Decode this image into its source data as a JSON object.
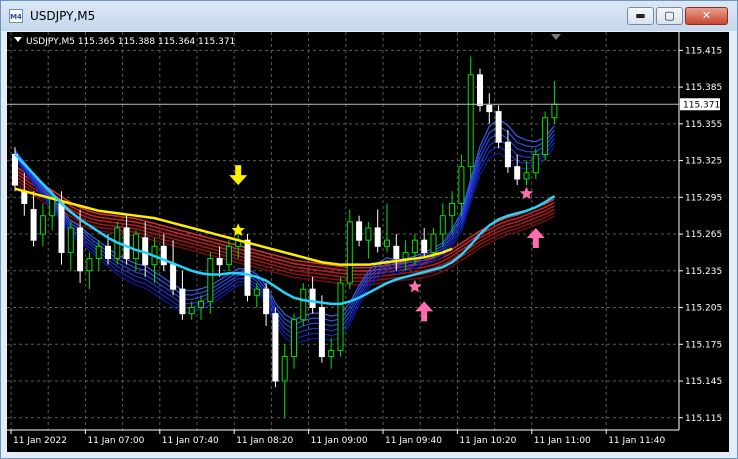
{
  "window": {
    "title": "USDJPY,M5",
    "app_icon_text": "M4",
    "buttons": {
      "minimize": "▬",
      "maximize": "▢",
      "close": "✕"
    }
  },
  "chart_data": {
    "type": "candlestick",
    "symbol_header": "USDJPY,M5  115.365 115.388 115.364 115.371",
    "bid": 115.371,
    "bid_label": "115.371",
    "ylim": [
      115.105,
      115.43
    ],
    "yticks": [
      "115.415",
      "115.385",
      "115.355",
      "115.325",
      "115.295",
      "115.265",
      "115.235",
      "115.205",
      "115.175",
      "115.145",
      "115.115"
    ],
    "xticks": [
      "11 Jan 2022",
      "11 Jan 07:00",
      "11 Jan 07:40",
      "11 Jan 08:20",
      "11 Jan 09:00",
      "11 Jan 09:40",
      "11 Jan 10:20",
      "11 Jan 11:00",
      "11 Jan 11:40"
    ],
    "grid": true,
    "colors": {
      "background": "#000000",
      "grid": "#5a5a5a",
      "bull_candle": "#00e000",
      "bear_candle": "#ffffff",
      "axis_text": "#ffffff",
      "bid_line": "#c0c0c0",
      "fast_ribbon": "#1a2fd6",
      "slow_ribbon": "#a01818",
      "cyan_line": "#22d4ff",
      "yellow_line": "#ffee00",
      "yellow_signal": "#ffee00",
      "pink_signal": "#ff6fb0"
    },
    "candles": [
      [
        115.33,
        115.336,
        115.3,
        115.305
      ],
      [
        115.3,
        115.315,
        115.28,
        115.29
      ],
      [
        115.285,
        115.3,
        115.255,
        115.26
      ],
      [
        115.265,
        115.29,
        115.255,
        115.28
      ],
      [
        115.28,
        115.3,
        115.268,
        115.295
      ],
      [
        115.29,
        115.3,
        115.24,
        115.25
      ],
      [
        115.25,
        115.275,
        115.235,
        115.27
      ],
      [
        115.27,
        115.285,
        115.225,
        115.235
      ],
      [
        115.235,
        115.25,
        115.22,
        115.245
      ],
      [
        115.245,
        115.26,
        115.235,
        115.255
      ],
      [
        115.255,
        115.265,
        115.24,
        115.245
      ],
      [
        115.245,
        115.275,
        115.24,
        115.27
      ],
      [
        115.27,
        115.28,
        115.24,
        115.245
      ],
      [
        115.245,
        115.268,
        115.235,
        115.265
      ],
      [
        115.262,
        115.275,
        115.23,
        115.24
      ],
      [
        115.24,
        115.262,
        115.225,
        115.255
      ],
      [
        115.255,
        115.265,
        115.235,
        115.24
      ],
      [
        115.24,
        115.26,
        115.215,
        115.22
      ],
      [
        115.22,
        115.235,
        115.195,
        115.2
      ],
      [
        115.2,
        115.21,
        115.195,
        115.205
      ],
      [
        115.205,
        115.215,
        115.195,
        115.21
      ],
      [
        115.21,
        115.25,
        115.2,
        115.245
      ],
      [
        115.245,
        115.255,
        115.23,
        115.24
      ],
      [
        115.24,
        115.26,
        115.235,
        115.255
      ],
      [
        115.255,
        115.27,
        115.245,
        115.26
      ],
      [
        115.26,
        115.265,
        115.21,
        115.215
      ],
      [
        115.215,
        115.225,
        115.205,
        115.22
      ],
      [
        115.22,
        115.225,
        115.19,
        115.2
      ],
      [
        115.2,
        115.205,
        115.14,
        115.145
      ],
      [
        115.145,
        115.175,
        115.115,
        115.165
      ],
      [
        115.165,
        115.2,
        115.155,
        115.195
      ],
      [
        115.195,
        115.225,
        115.19,
        115.22
      ],
      [
        115.22,
        115.23,
        115.2,
        115.205
      ],
      [
        115.205,
        115.215,
        115.16,
        115.165
      ],
      [
        115.165,
        115.18,
        115.155,
        115.17
      ],
      [
        115.17,
        115.23,
        115.165,
        115.225
      ],
      [
        115.225,
        115.285,
        115.22,
        115.275
      ],
      [
        115.275,
        115.28,
        115.255,
        115.26
      ],
      [
        115.26,
        115.275,
        115.245,
        115.27
      ],
      [
        115.27,
        115.285,
        115.25,
        115.255
      ],
      [
        115.255,
        115.29,
        115.25,
        115.26
      ],
      [
        115.255,
        115.265,
        115.235,
        115.245
      ],
      [
        115.245,
        115.26,
        115.235,
        115.25
      ],
      [
        115.25,
        115.265,
        115.24,
        115.26
      ],
      [
        115.26,
        115.27,
        115.245,
        115.25
      ],
      [
        115.25,
        115.27,
        115.245,
        115.265
      ],
      [
        115.265,
        115.29,
        115.255,
        115.28
      ],
      [
        115.28,
        115.3,
        115.265,
        115.29
      ],
      [
        115.29,
        115.33,
        115.28,
        115.32
      ],
      [
        115.32,
        115.41,
        115.31,
        115.395
      ],
      [
        115.395,
        115.4,
        115.365,
        115.37
      ],
      [
        115.37,
        115.38,
        115.355,
        115.365
      ],
      [
        115.365,
        115.37,
        115.335,
        115.34
      ],
      [
        115.34,
        115.35,
        115.315,
        115.32
      ],
      [
        115.32,
        115.33,
        115.305,
        115.31
      ],
      [
        115.31,
        115.325,
        115.305,
        115.315
      ],
      [
        115.315,
        115.335,
        115.31,
        115.33
      ],
      [
        115.33,
        115.365,
        115.325,
        115.36
      ],
      [
        115.36,
        115.39,
        115.355,
        115.371
      ]
    ],
    "indicators": {
      "fast_ribbon": {
        "count": 6,
        "center": [
          115.33,
          115.32,
          115.31,
          115.3,
          115.29,
          115.28,
          115.27,
          115.265,
          115.258,
          115.252,
          115.246,
          115.24,
          115.236,
          115.232,
          115.23,
          115.225,
          115.22,
          115.215,
          115.21,
          115.21,
          115.212,
          115.215,
          115.22,
          115.225,
          115.23,
          115.23,
          115.225,
          115.215,
          115.2,
          115.19,
          115.185,
          115.188,
          115.19,
          115.19,
          115.188,
          115.19,
          115.2,
          115.215,
          115.228,
          115.235,
          115.24,
          115.238,
          115.24,
          115.242,
          115.245,
          115.248,
          115.252,
          115.262,
          115.275,
          115.3,
          115.325,
          115.34,
          115.345,
          115.34,
          115.332,
          115.33,
          115.33,
          115.335,
          115.345
        ],
        "spread": [
          0.008,
          0.009,
          0.01,
          0.011,
          0.012,
          0.013,
          0.014,
          0.015,
          0.016,
          0.017,
          0.018,
          0.019,
          0.02,
          0.021,
          0.022,
          0.022,
          0.022,
          0.022,
          0.022,
          0.021,
          0.02,
          0.019,
          0.018,
          0.017,
          0.016,
          0.016,
          0.017,
          0.019,
          0.021,
          0.023,
          0.024,
          0.025,
          0.025,
          0.025,
          0.024,
          0.023,
          0.021,
          0.019,
          0.017,
          0.015,
          0.014,
          0.013,
          0.012,
          0.012,
          0.012,
          0.013,
          0.014,
          0.016,
          0.019,
          0.023,
          0.028,
          0.031,
          0.033,
          0.033,
          0.031,
          0.028,
          0.025,
          0.022,
          0.02
        ]
      },
      "slow_ribbon": {
        "count": 6,
        "center": [
          115.315,
          115.31,
          115.305,
          115.3,
          115.295,
          115.29,
          115.285,
          115.281,
          115.278,
          115.276,
          115.275,
          115.274,
          115.273,
          115.272,
          115.27,
          115.268,
          115.266,
          115.264,
          115.262,
          115.26,
          115.258,
          115.256,
          115.254,
          115.252,
          115.25,
          115.248,
          115.246,
          115.244,
          115.242,
          115.24,
          115.238,
          115.237,
          115.236,
          115.235,
          115.234,
          115.233,
          115.232,
          115.232,
          115.232,
          115.233,
          115.234,
          115.235,
          115.236,
          115.237,
          115.238,
          115.24,
          115.243,
          115.247,
          115.252,
          115.257,
          115.262,
          115.266,
          115.27,
          115.273,
          115.275,
          115.278,
          115.281,
          115.284,
          115.288
        ],
        "spread": 0.0028
      },
      "cyan_line": [
        115.33,
        115.322,
        115.314,
        115.306,
        115.298,
        115.29,
        115.283,
        115.277,
        115.272,
        115.267,
        115.262,
        115.258,
        115.255,
        115.252,
        115.25,
        115.247,
        115.244,
        115.241,
        115.238,
        115.235,
        115.233,
        115.232,
        115.232,
        115.233,
        115.233,
        115.232,
        115.23,
        115.227,
        115.222,
        115.217,
        115.213,
        115.211,
        115.21,
        115.209,
        115.208,
        115.208,
        115.21,
        115.213,
        115.217,
        115.221,
        115.225,
        115.228,
        115.23,
        115.232,
        115.234,
        115.236,
        115.238,
        115.242,
        115.248,
        115.256,
        115.265,
        115.272,
        115.277,
        115.28,
        115.282,
        115.284,
        115.287,
        115.291,
        115.296
      ],
      "yellow_line": [
        115.302,
        115.3,
        115.298,
        115.296,
        115.294,
        115.292,
        115.29,
        115.288,
        115.286,
        115.284,
        115.283,
        115.282,
        115.281,
        115.28,
        115.279,
        115.278,
        115.276,
        115.274,
        115.272,
        115.27,
        115.268,
        115.266,
        115.264,
        115.262,
        115.26,
        115.258,
        115.256,
        115.254,
        115.252,
        115.25,
        115.248,
        115.246,
        115.244,
        115.242,
        115.241,
        115.24,
        115.24,
        115.24,
        115.24,
        115.241,
        115.242,
        115.243,
        115.244,
        115.245,
        115.246,
        115.248,
        115.25,
        115.253
      ]
    },
    "signals": [
      {
        "kind": "down-arrow",
        "color": "yellow",
        "bar": 24,
        "price": 115.305
      },
      {
        "kind": "star",
        "color": "yellow",
        "bar": 24,
        "price": 115.268
      },
      {
        "kind": "star",
        "color": "pink",
        "bar": 43,
        "price": 115.222
      },
      {
        "kind": "up-arrow",
        "color": "pink",
        "bar": 44,
        "price": 115.21
      },
      {
        "kind": "star",
        "color": "pink",
        "bar": 55,
        "price": 115.298
      },
      {
        "kind": "up-arrow",
        "color": "pink",
        "bar": 56,
        "price": 115.27
      }
    ]
  }
}
